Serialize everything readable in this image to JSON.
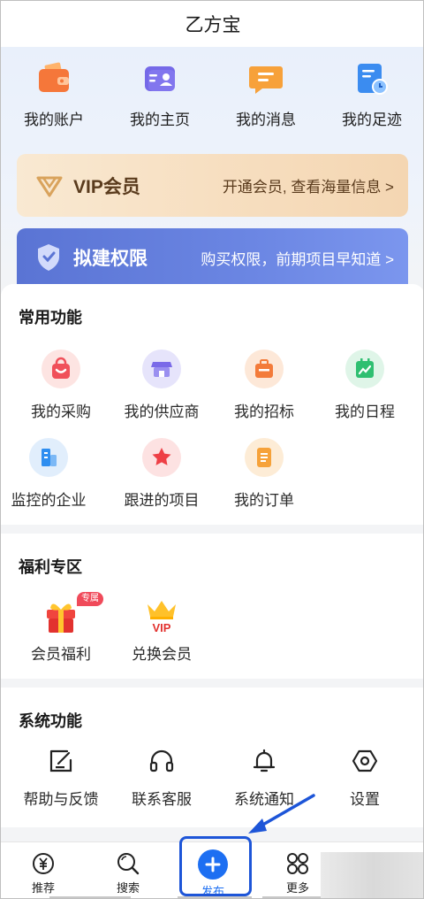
{
  "app": {
    "title": "乙方宝"
  },
  "quick_links": [
    {
      "label": "我的账户",
      "icon": "wallet-icon"
    },
    {
      "label": "我的主页",
      "icon": "id-card-icon"
    },
    {
      "label": "我的消息",
      "icon": "message-icon"
    },
    {
      "label": "我的足迹",
      "icon": "history-icon"
    }
  ],
  "vip": {
    "title": "VIP会员",
    "subtitle": "开通会员, 查看海量信息 >"
  },
  "plan": {
    "title": "拟建权限",
    "subtitle": "购买权限，前期项目早知道 >"
  },
  "common": {
    "title": "常用功能",
    "items": [
      {
        "label": "我的采购",
        "icon": "shopping-bag-icon"
      },
      {
        "label": "我的供应商",
        "icon": "store-icon"
      },
      {
        "label": "我的招标",
        "icon": "briefcase-icon"
      },
      {
        "label": "我的日程",
        "icon": "calendar-chart-icon"
      },
      {
        "label": "监控的企业",
        "icon": "building-icon"
      },
      {
        "label": "跟进的项目",
        "icon": "star-icon"
      },
      {
        "label": "我的订单",
        "icon": "order-icon"
      }
    ]
  },
  "welfare": {
    "title": "福利专区",
    "badge": "专属",
    "items": [
      {
        "label": "会员福利",
        "icon": "gift-icon"
      },
      {
        "label": "兑换会员",
        "icon": "vip-crown-icon",
        "icon_text": "VIP"
      }
    ]
  },
  "system": {
    "title": "系统功能",
    "items": [
      {
        "label": "帮助与反馈",
        "icon": "feedback-icon"
      },
      {
        "label": "联系客服",
        "icon": "headset-icon"
      },
      {
        "label": "系统通知",
        "icon": "bell-icon"
      },
      {
        "label": "设置",
        "icon": "settings-icon"
      }
    ]
  },
  "tabbar": {
    "items": [
      {
        "label": "推荐",
        "icon": "yen-icon"
      },
      {
        "label": "搜索",
        "icon": "search-icon"
      },
      {
        "label": "发布",
        "icon": "plus-icon"
      },
      {
        "label": "更多",
        "icon": "grid-icon"
      }
    ]
  },
  "colors": {
    "accent": "#1d6ff2",
    "vip_text": "#5a3b1d",
    "plan_bg": "#5a74d4"
  }
}
